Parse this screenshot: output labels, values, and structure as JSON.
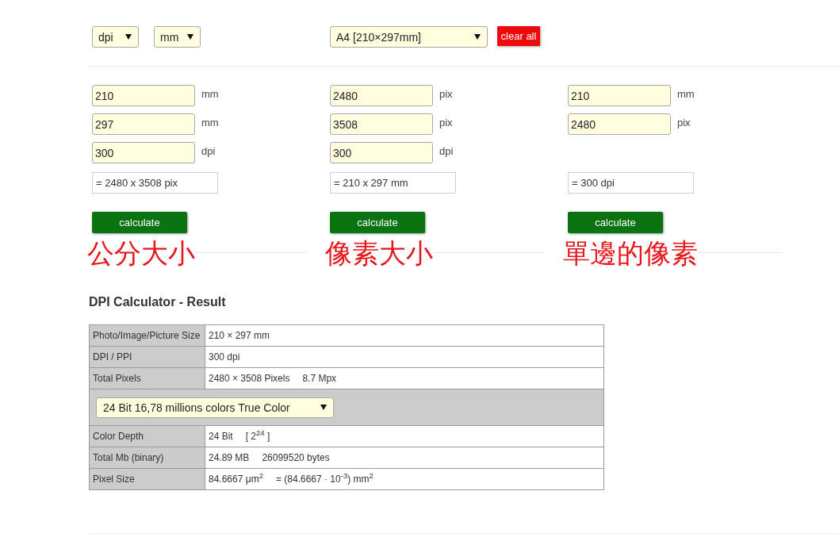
{
  "toolbar": {
    "unit_dropdowns": [
      {
        "value": "dpi"
      },
      {
        "value": "mm"
      }
    ],
    "paper_dropdown": {
      "value": "A4 [210×297mm]"
    },
    "clear_button": {
      "label": "clear all"
    }
  },
  "calculators": [
    {
      "fields": [
        {
          "value": "210",
          "unit": "mm"
        },
        {
          "value": "297",
          "unit": "mm"
        },
        {
          "value": "300",
          "unit": "dpi"
        }
      ],
      "result": "= 2480 x 3508 pix",
      "button": "calculate",
      "annotation": "公分大小"
    },
    {
      "fields": [
        {
          "value": "2480",
          "unit": "pix"
        },
        {
          "value": "3508",
          "unit": "pix"
        },
        {
          "value": "300",
          "unit": "dpi"
        }
      ],
      "result": "= 210 x 297 mm",
      "button": "calculate",
      "annotation": "像素大小"
    },
    {
      "fields": [
        {
          "value": "210",
          "unit": "mm"
        },
        {
          "value": "2480",
          "unit": "pix"
        }
      ],
      "result": "= 300 dpi",
      "button": "calculate",
      "annotation": "單邊的像素"
    }
  ],
  "result_section": {
    "title": "DPI Calculator - Result",
    "rows": [
      {
        "kind": "pair",
        "label": "Photo/Image/Picture Size",
        "values": [
          "210 × 297 mm"
        ]
      },
      {
        "kind": "pair",
        "label": "DPI / PPI",
        "values": [
          "300 dpi"
        ]
      },
      {
        "kind": "pair",
        "label": "Total Pixels",
        "values": [
          "2480 × 3508 Pixels",
          "8.7 Mpx"
        ]
      },
      {
        "kind": "dropdown",
        "value": "24 Bit 16,78 millions colors True Color"
      },
      {
        "kind": "pair",
        "label": "Color Depth",
        "values": [
          "24 Bit",
          "[ 2$^{24}$ ]"
        ]
      },
      {
        "kind": "pair",
        "label": "Total Mb (binary)",
        "values": [
          "24.89 MB",
          "26099520 bytes"
        ]
      },
      {
        "kind": "pair",
        "label": "Pixel Size",
        "values": [
          "84.6667 μm$^{2}$",
          "= (84.6667 · 10$^{-3}$) mm$^{2}$"
        ]
      }
    ]
  }
}
